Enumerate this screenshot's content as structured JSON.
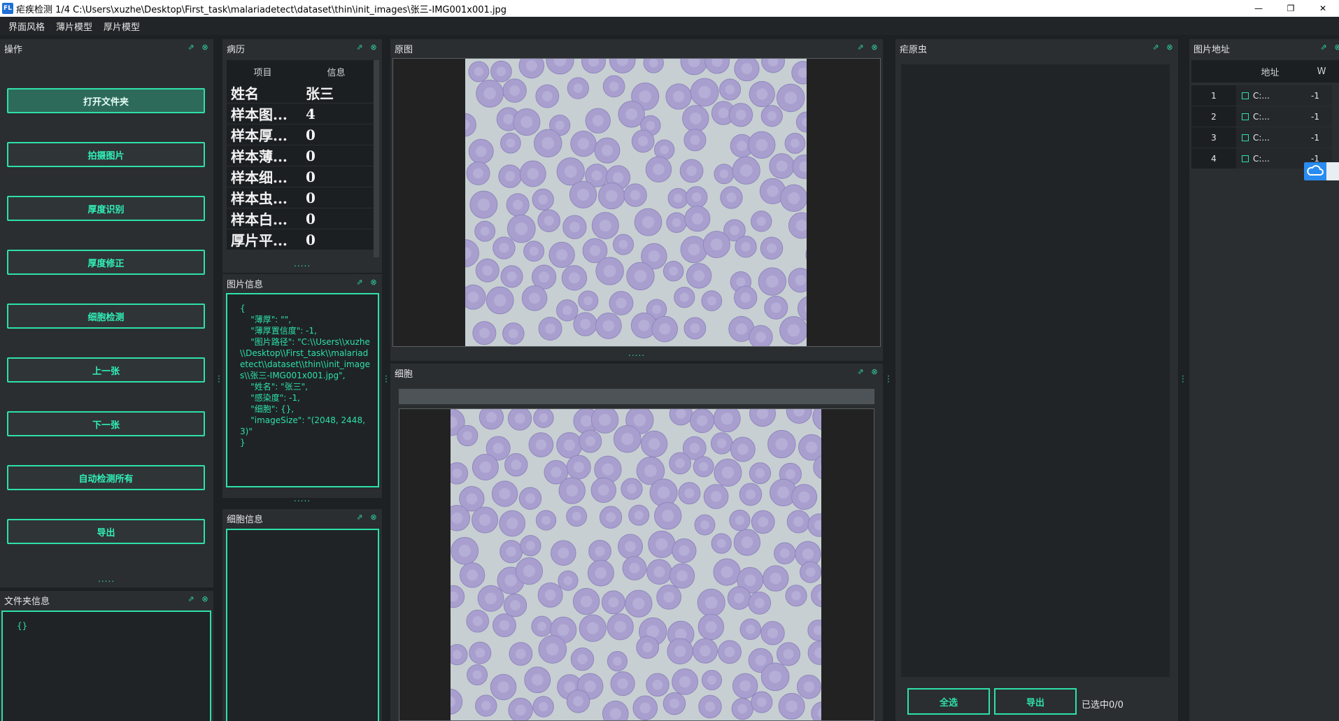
{
  "window": {
    "icon_text": "FL",
    "title": "疟疾检测 1/4 C:\\Users\\xuzhe\\Desktop\\First_task\\malariadetect\\dataset\\thin\\init_images\\张三-IMG001x001.jpg",
    "minimize": "—",
    "restore": "❐",
    "close": "✕"
  },
  "menu": [
    "界面风格",
    "薄片模型",
    "厚片模型"
  ],
  "dock_icons": {
    "float": "⇗",
    "close": "⊗"
  },
  "ops_panel": {
    "title": "操作",
    "buttons": [
      "打开文件夹",
      "拍摄图片",
      "厚度识别",
      "厚度修正",
      "细胞检测",
      "上一张",
      "下一张",
      "自动检测所有",
      "导出"
    ],
    "more": "....."
  },
  "folder_panel": {
    "title": "文件夹信息",
    "content": "{}"
  },
  "record_panel": {
    "title": "病历",
    "headers": [
      "项目",
      "信息"
    ],
    "rows": [
      {
        "k": "姓名",
        "v": "张三"
      },
      {
        "k": "样本图...",
        "v": "4"
      },
      {
        "k": "样本厚...",
        "v": "0"
      },
      {
        "k": "样本薄...",
        "v": "0"
      },
      {
        "k": "样本细...",
        "v": "0"
      },
      {
        "k": "样本虫...",
        "v": "0"
      },
      {
        "k": "样本白...",
        "v": "0"
      },
      {
        "k": "厚片平...",
        "v": "0"
      }
    ],
    "more": "....."
  },
  "image_info_panel": {
    "title": "图片信息",
    "content": "{\n    \"薄厚\": \"\",\n    \"薄厚置信度\": -1,\n    \"图片路径\": \"C:\\\\Users\\\\xuzhe\\\\Desktop\\\\First_task\\\\malariadetect\\\\dataset\\\\thin\\\\init_images\\\\张三-IMG001x001.jpg\",\n    \"姓名\": \"张三\",\n    \"感染度\": -1,\n    \"细胞\": {},\n    \"imageSize\": \"(2048, 2448, 3)\"\n}",
    "more": "....."
  },
  "cell_info_panel": {
    "title": "细胞信息"
  },
  "original_panel": {
    "title": "原图",
    "more": "....."
  },
  "cell_panel": {
    "title": "细胞"
  },
  "parasite_panel": {
    "title": "疟原虫",
    "select_all": "全选",
    "export": "导出",
    "selected": "已选中0/0"
  },
  "address_panel": {
    "title": "图片地址",
    "headers": [
      "",
      "地址",
      "W"
    ],
    "rows": [
      {
        "n": "1",
        "addr": "C:...",
        "w": "-1"
      },
      {
        "n": "2",
        "addr": "C:...",
        "w": "-1"
      },
      {
        "n": "3",
        "addr": "C:...",
        "w": "-1"
      },
      {
        "n": "4",
        "addr": "C:...",
        "w": "-1"
      }
    ]
  },
  "cloud_icon": "cloud-icon",
  "colors": {
    "accent": "#2ee0a8",
    "panel": "#2a2e31",
    "background": "#1e2124"
  }
}
